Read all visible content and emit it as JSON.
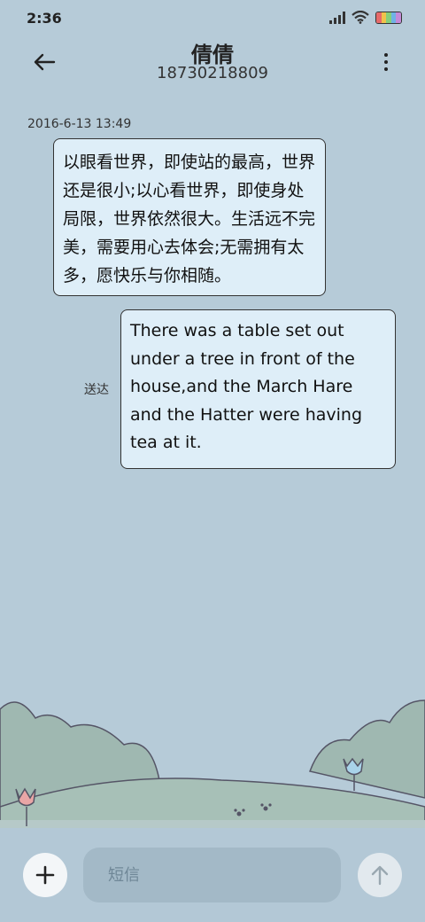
{
  "status_bar": {
    "time": "2:36"
  },
  "header": {
    "contact_name": "倩倩",
    "contact_number": "18730218809"
  },
  "conversation": {
    "timestamp": "2016-6-13 13:49",
    "messages": [
      {
        "direction": "incoming",
        "text": "以眼看世界，即使站的最高，世界还是很小;以心看世界，即使身处局限，世界依然很大。生活远不完美，需要用心去体会;无需拥有太多，愿快乐与你相随。"
      },
      {
        "direction": "outgoing",
        "text": "There was a table set out under a tree in front of the house,and the March Hare and the Hatter were having tea at it.",
        "status": "送达"
      }
    ]
  },
  "composer": {
    "placeholder": "短信"
  },
  "colors": {
    "background": "#b6cbd8",
    "bubble": "#deeef8",
    "bubble_border": "#333333"
  }
}
